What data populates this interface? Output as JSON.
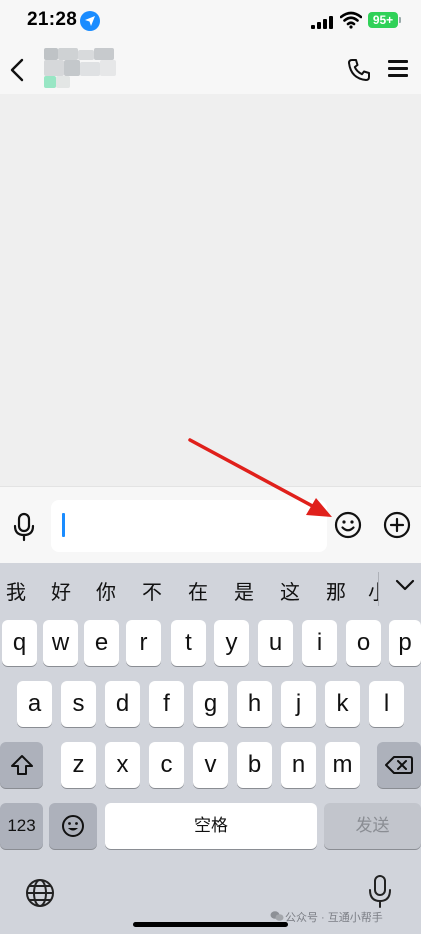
{
  "status_bar": {
    "time": "21:28",
    "battery": "95+"
  },
  "chat": {
    "contact_name": ""
  },
  "input": {
    "value": "",
    "placeholder": ""
  },
  "candidates": [
    "我",
    "好",
    "你",
    "不",
    "在",
    "是",
    "这",
    "那",
    "小"
  ],
  "keyboard": {
    "row1": [
      "q",
      "w",
      "e",
      "r",
      "t",
      "y",
      "u",
      "i",
      "o",
      "p"
    ],
    "row2": [
      "a",
      "s",
      "d",
      "f",
      "g",
      "h",
      "j",
      "k",
      "l"
    ],
    "row3": [
      "z",
      "x",
      "c",
      "v",
      "b",
      "n",
      "m"
    ],
    "num_label": "123",
    "space_label": "空格",
    "send_label": "发送"
  },
  "watermark": "公众号 · 互通小帮手",
  "colors": {
    "accent": "#1a8cff",
    "battery": "#30d158",
    "annotation": "#e0201b"
  },
  "icons": [
    "location-arrow-icon",
    "signal-icon",
    "wifi-icon",
    "back-icon",
    "phone-icon",
    "menu-icon",
    "microphone-icon",
    "emoji-icon",
    "plus-icon",
    "shift-icon",
    "delete-icon",
    "keyboard-emoji-icon",
    "globe-icon",
    "dictation-icon",
    "chevron-down-icon"
  ]
}
